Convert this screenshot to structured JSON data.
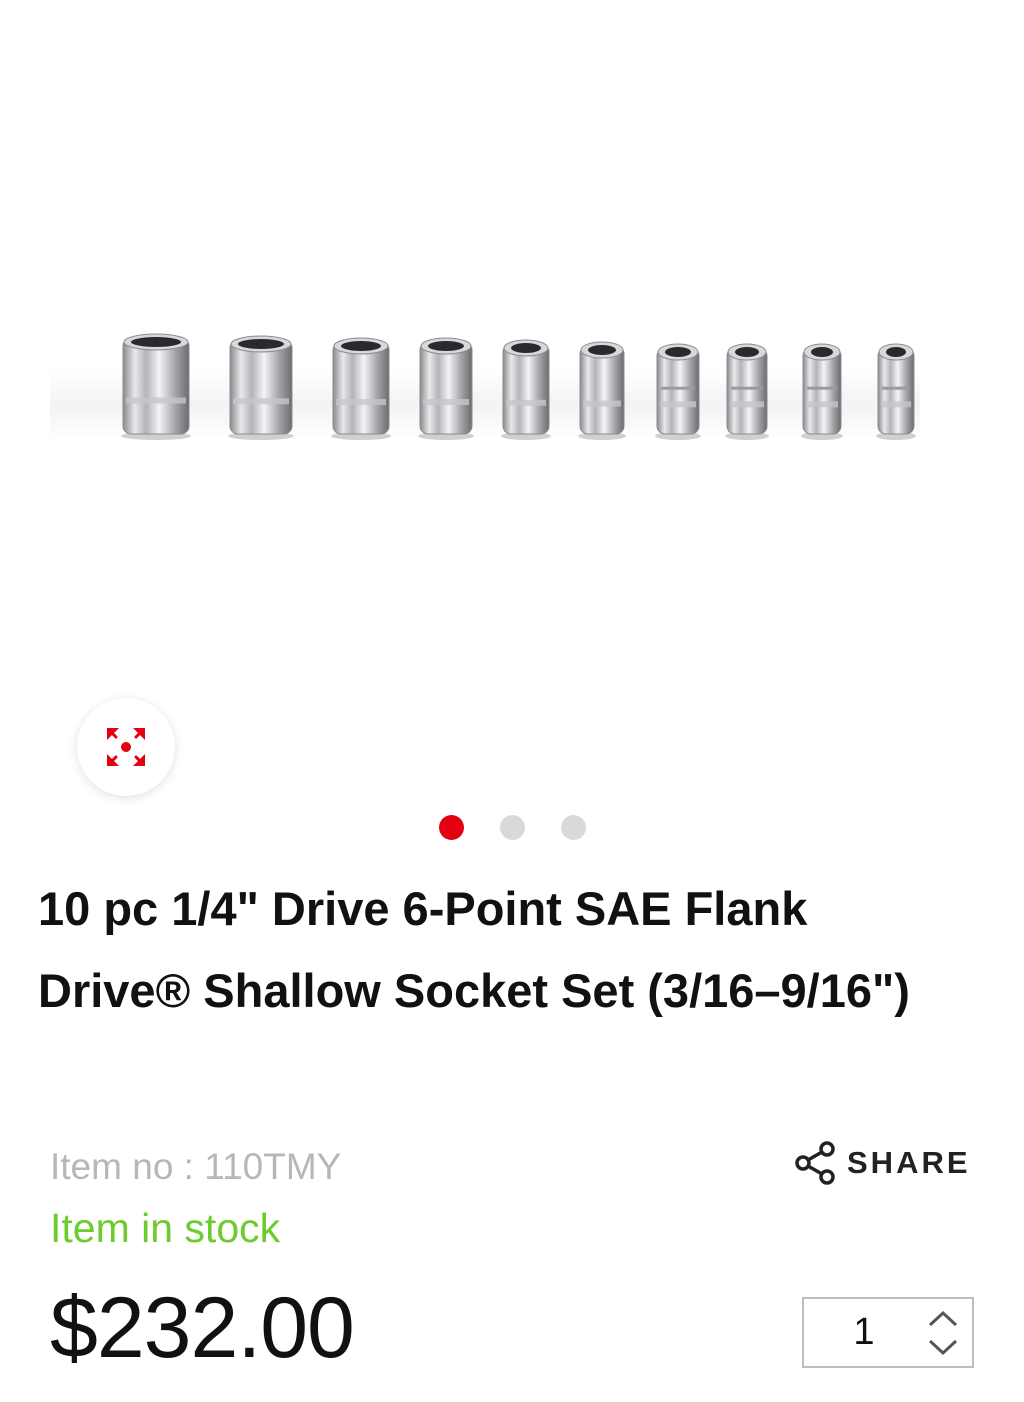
{
  "gallery": {
    "image_alt": "10 chrome shallow sockets in a row",
    "socket_count": 10,
    "zoom_icon": "expand-icon",
    "active_slide": 1,
    "slide_count": 3,
    "colors": {
      "active_dot": "#e3000f",
      "inactive_dot": "#d9d9d9",
      "zoom_icon": "#e3000f"
    }
  },
  "product": {
    "title": "10 pc 1/4\" Drive 6-Point SAE Flank Drive® Shallow Socket Set (3/16–9/16\")",
    "item_no": "Item no : 110TMY",
    "stock_status": "Item in stock",
    "price": "$232.00",
    "colors": {
      "stock": "#6ccc2e",
      "item_no": "#b7b7b7"
    }
  },
  "share": {
    "label": "SHARE",
    "icon": "share-icon"
  },
  "quantity": {
    "value": "1",
    "icons": [
      "chevron-up-icon",
      "chevron-down-icon"
    ]
  }
}
